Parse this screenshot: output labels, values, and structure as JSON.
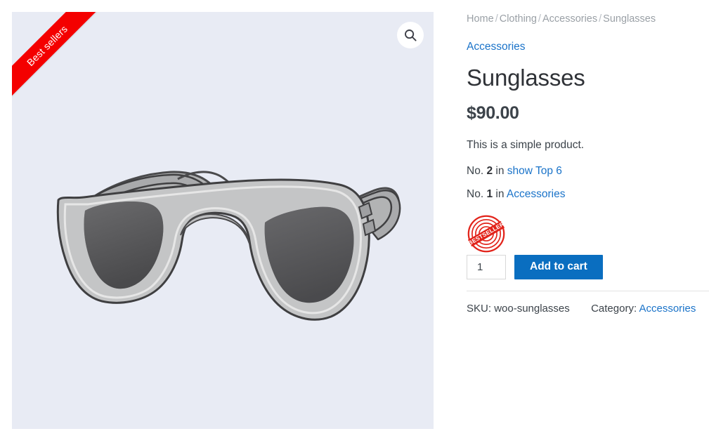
{
  "colors": {
    "accent_blue": "#0a6ec0",
    "link_blue": "#1a73c9",
    "ribbon_red": "#f40000",
    "stamp_red": "#e2231a",
    "gallery_bg": "#e8ebf4",
    "text_dark": "#3c434a",
    "breadcrumb_gray": "#9aa0a6"
  },
  "gallery": {
    "ribbon_label": "Best sellers",
    "zoom_icon": "magnifier-icon",
    "product_image_alt": "sunglasses-illustration"
  },
  "summary": {
    "breadcrumb": {
      "items": [
        "Home",
        "Clothing",
        "Accessories",
        "Sunglasses"
      ],
      "separator": "/"
    },
    "category_link": "Accessories",
    "title": "Sunglasses",
    "price": "$90.00",
    "short_description": "This is a simple product.",
    "rankings": [
      {
        "prefix": "No.",
        "rank": "2",
        "middle": "in",
        "link": "show Top 6"
      },
      {
        "prefix": "No.",
        "rank": "1",
        "middle": "in",
        "link": "Accessories"
      }
    ],
    "badge": {
      "name": "bestseller-stamp",
      "text": "BESTSELLER"
    },
    "cart": {
      "quantity_value": "1",
      "quantity_placeholder": "1",
      "add_to_cart_label": "Add to cart"
    },
    "meta": {
      "sku_label": "SKU:",
      "sku_value": "woo-sunglasses",
      "category_label": "Category:",
      "category_value": "Accessories"
    }
  }
}
